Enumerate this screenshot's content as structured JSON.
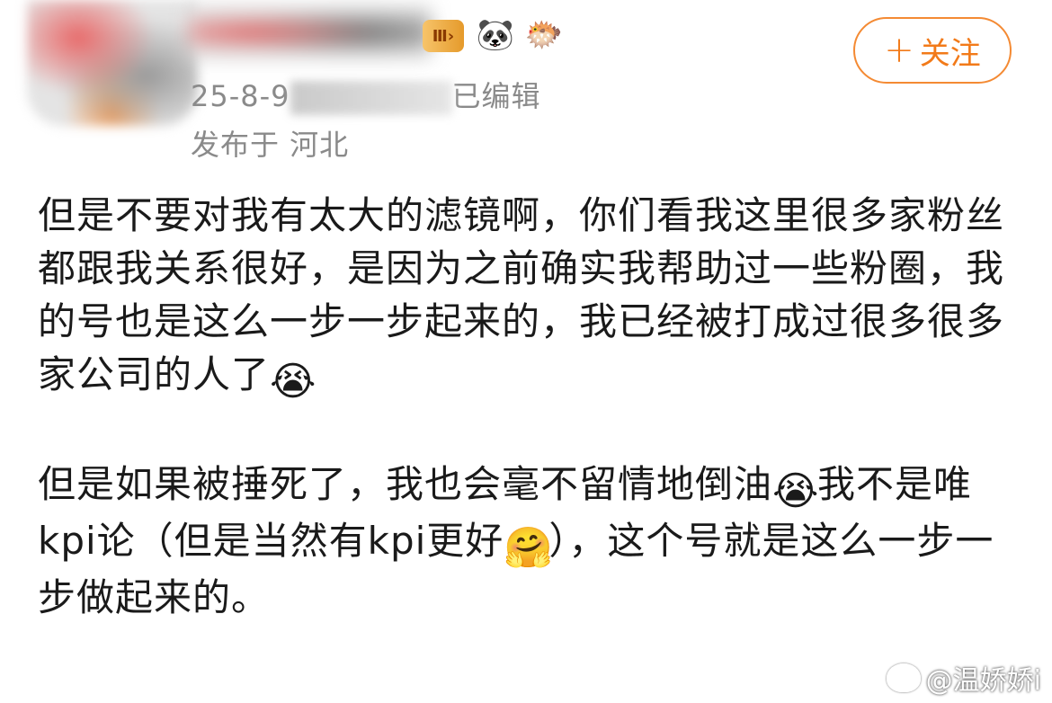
{
  "header": {
    "vip_badge": "Ⅲ›",
    "badge_icons": [
      "panda-icon",
      "fish-icon"
    ],
    "follow_label": "关注",
    "follow_plus": "+",
    "time_visible": "25-8-9",
    "time_suffix": "已编辑",
    "location": "发布于 河北"
  },
  "post": {
    "paragraph1_text": "但是不要对我有太大的滤镜啊，你们看我这里很多家粉丝都跟我关系很好，是因为之前确实我帮助过一些粉圈，我的号也是这么一步一步起来的，我已经被打成过很多很多家公司的人了",
    "paragraph2_part1": "但是如果被捶死了，我也会毫不留情地倒油",
    "paragraph2_part2": "我不是唯kpi论（但是当然有kpi更好",
    "paragraph2_part3": "），这个号就是这么一步一步做起来的。",
    "emoji_crying": "😭",
    "emoji_hug": "🤗"
  },
  "watermark": {
    "text": "@温娇娇i"
  },
  "colors": {
    "accent": "#f27a19",
    "meta_text": "#8a8a8a",
    "body_text": "#1a1a1a"
  }
}
